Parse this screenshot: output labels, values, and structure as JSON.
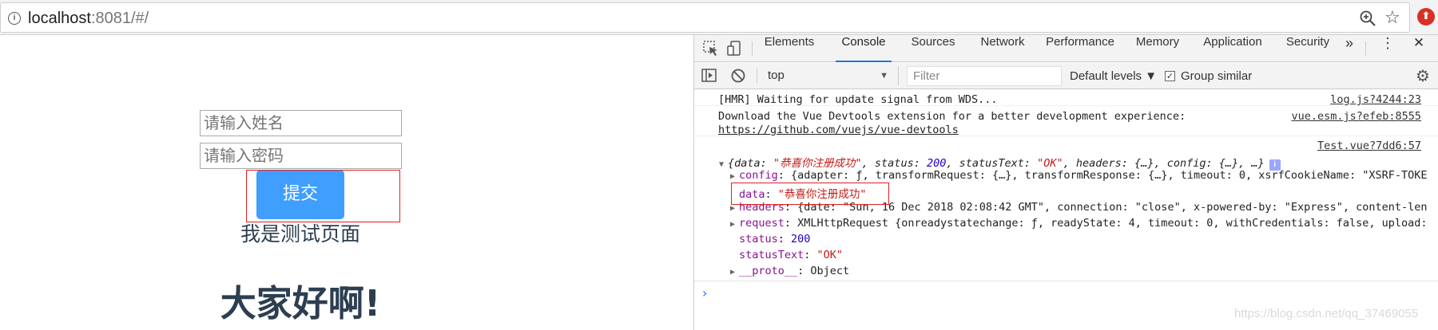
{
  "browser": {
    "url_host": "localhost",
    "url_rest": ":8081/#/",
    "info_icon": "i",
    "extension_icon": "⬆"
  },
  "page": {
    "name_placeholder": "请输入姓名",
    "password_placeholder": "请输入密码",
    "submit_label": "提交",
    "test_label": "我是测试页面",
    "greeting": "大家好啊!"
  },
  "devtools": {
    "tabs": [
      "Elements",
      "Console",
      "Sources",
      "Network",
      "Performance",
      "Memory",
      "Application",
      "Security"
    ],
    "more_tabs": "»",
    "menu": "⋮",
    "close": "✕",
    "context": "top",
    "filter_placeholder": "Filter",
    "levels": "Default levels ▼",
    "group_check": "✓",
    "group_similar": "Group similar",
    "gear_icon": "⚙",
    "messages": {
      "hmr": {
        "text": "[HMR] Waiting for update signal from WDS...",
        "source": "log.js?4244:23"
      },
      "vue_devtools": {
        "text": "Download the Vue Devtools extension for a better development experience:",
        "link": "https://github.com/vuejs/vue-devtools",
        "source": "vue.esm.js?efeb:8555"
      },
      "response": {
        "source": "Test.vue?7dd6:57",
        "summary_parts": [
          "{data: ",
          "\"恭喜你注册成功\"",
          ", status: ",
          "200",
          ", statusText: ",
          "\"OK\"",
          ", headers: {…}, config: {…}, …}"
        ],
        "config_key": "config",
        "config_val": ": {adapter: ƒ, transformRequest: {…}, transformResponse: {…}, timeout: 0, xsrfCookieName: \"XSRF-TOKE",
        "data_key": "data",
        "data_val": "\"恭喜你注册成功\"",
        "headers_key": "headers",
        "headers_val": ": {date: \"Sun, 16 Dec 2018 02:08:42 GMT\", connection: \"close\", x-powered-by: \"Express\", content-len",
        "request_key": "request",
        "request_val": ": XMLHttpRequest {onreadystatechange: ƒ, readyState: 4, timeout: 0, withCredentials: false, upload:",
        "status_key": "status",
        "status_val": "200",
        "status_text_key": "statusText",
        "status_text_val": "\"OK\"",
        "proto_key": "__proto__",
        "proto_val": "Object",
        "info_badge": "i"
      }
    },
    "prompt": "›"
  },
  "watermark": "https://blog.csdn.net/qq_37469055"
}
